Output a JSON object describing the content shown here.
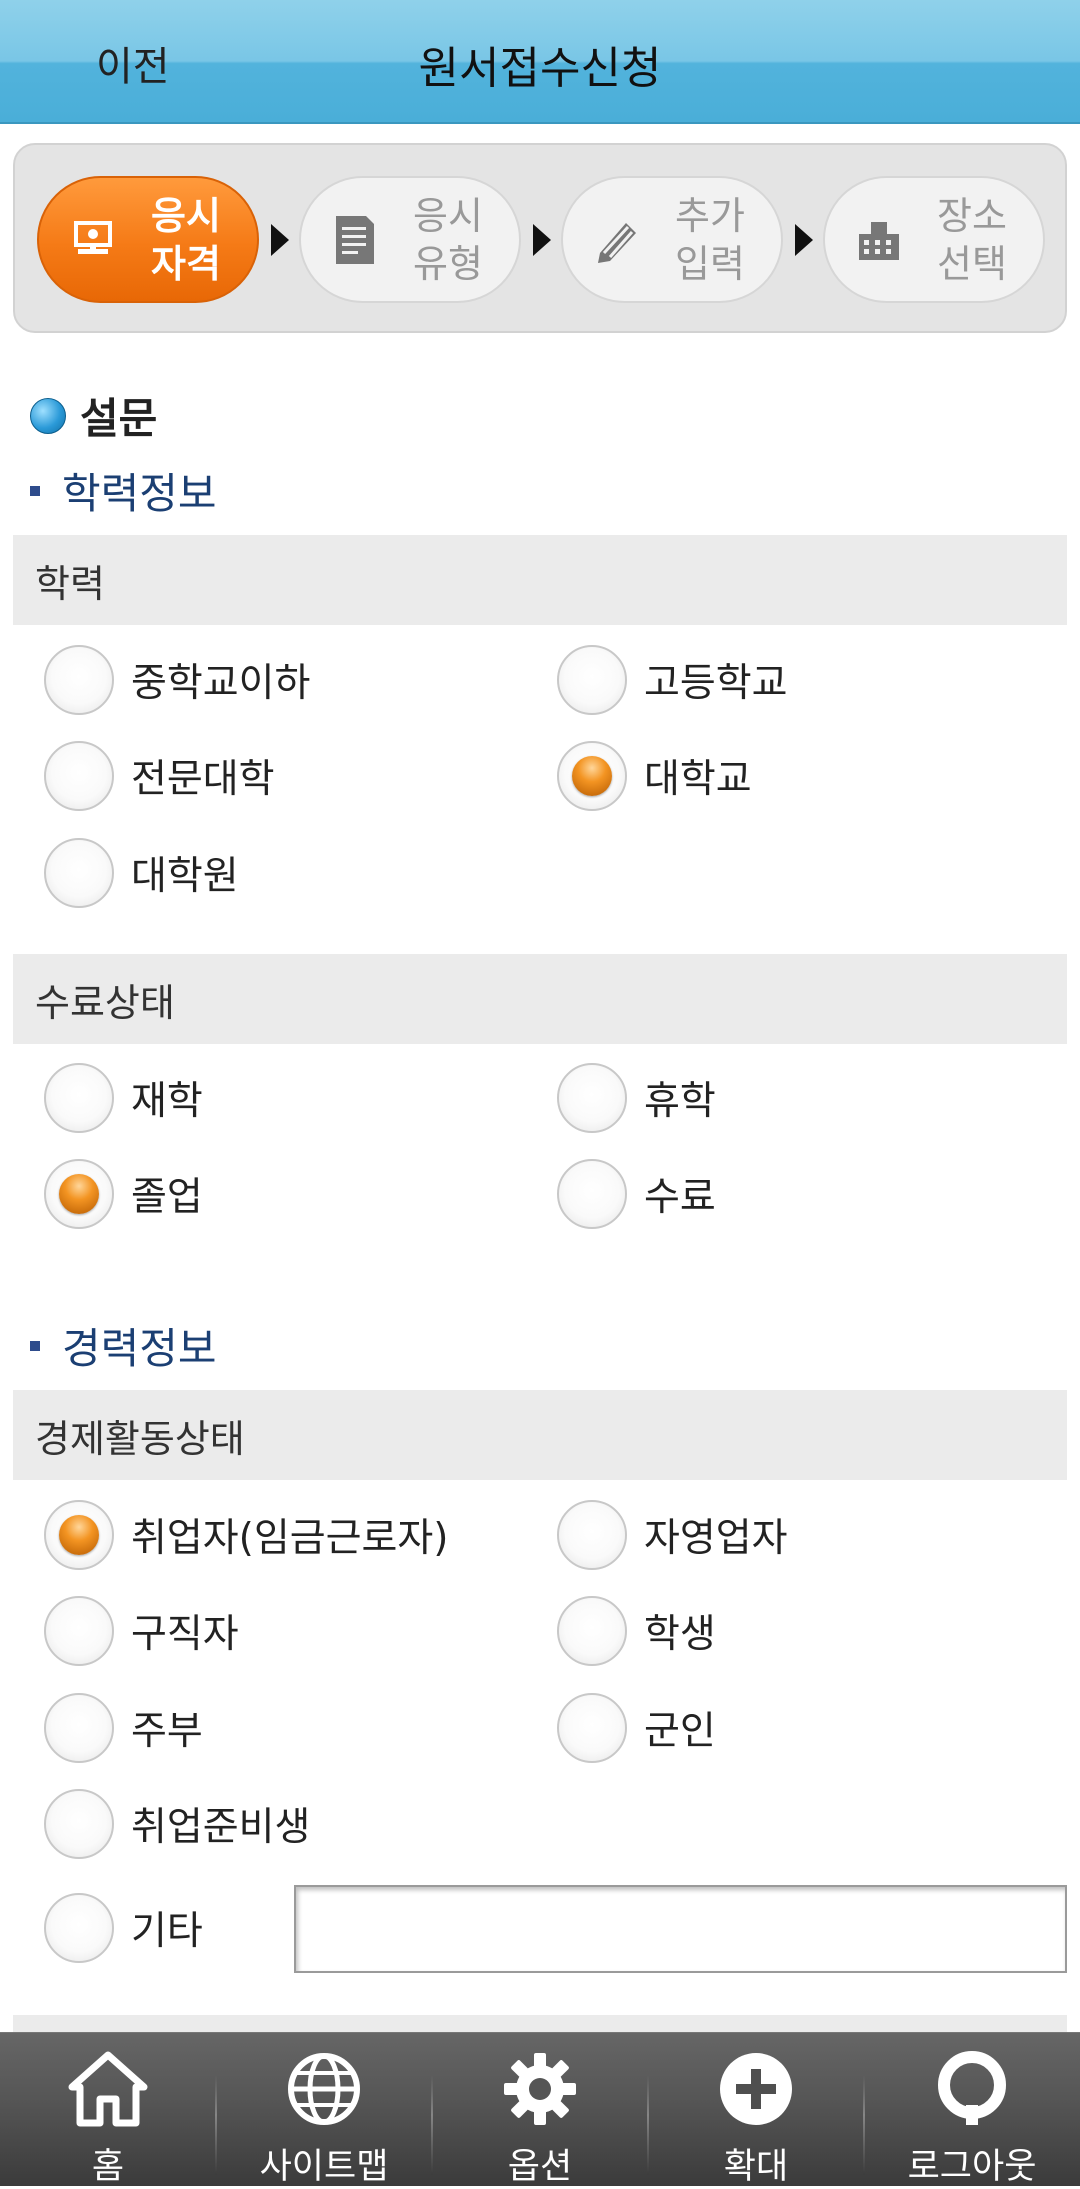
{
  "header": {
    "back_label": "이전",
    "title": "원서접수신청"
  },
  "steps": [
    {
      "label": "응시\n자격",
      "icon": "certificate-icon",
      "active": true
    },
    {
      "label": "응시\n유형",
      "icon": "document-icon",
      "active": false
    },
    {
      "label": "추가\n입력",
      "icon": "pencil-icon",
      "active": false
    },
    {
      "label": "장소\n선택",
      "icon": "building-icon",
      "active": false
    }
  ],
  "survey": {
    "title": "설문",
    "education": {
      "title": "학력정보",
      "level": {
        "label": "학력",
        "options": [
          "중학교이하",
          "고등학교",
          "전문대학",
          "대학교",
          "대학원"
        ],
        "selected": "대학교"
      },
      "status": {
        "label": "수료상태",
        "options": [
          "재학",
          "휴학",
          "졸업",
          "수료"
        ],
        "selected": "졸업"
      }
    },
    "career": {
      "title": "경력정보",
      "activity": {
        "label": "경제활동상태",
        "options": [
          "취업자(임금근로자)",
          "자영업자",
          "구직자",
          "학생",
          "주부",
          "군인",
          "취업준비생",
          "기타"
        ],
        "selected": "취업자(임금근로자)",
        "other_value": ""
      }
    }
  },
  "bottom_nav": [
    {
      "label": "홈",
      "icon": "home-icon"
    },
    {
      "label": "사이트맵",
      "icon": "globe-icon"
    },
    {
      "label": "옵션",
      "icon": "gear-icon"
    },
    {
      "label": "확대",
      "icon": "plus-circle-icon"
    },
    {
      "label": "로그아웃",
      "icon": "logout-icon"
    }
  ],
  "colors": {
    "header": "#79c6e6",
    "active_step": "#f57a16",
    "section_title": "#1b3f73",
    "nav_bg": "#4a4a4a"
  }
}
